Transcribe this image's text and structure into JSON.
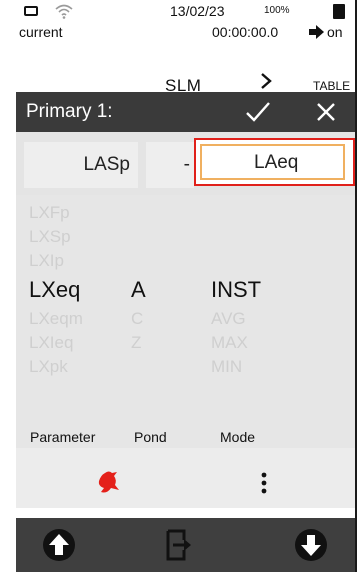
{
  "status_bar": {
    "date": "13/02/23",
    "battery_percent": "100%",
    "mode": "current",
    "timer": "00:00:00.0",
    "rec_state": "on"
  },
  "nav": {
    "title": "SLM",
    "next_label": "TABLE"
  },
  "header": {
    "title": "Primary 1:",
    "icons": [
      "check-icon",
      "close-icon"
    ]
  },
  "selection": {
    "field_a": "LASp",
    "field_b": "-",
    "field_c": "LAeq"
  },
  "picker": {
    "parameter": {
      "options": [
        "LXFp",
        "LXSp",
        "LXIp",
        "LXeq",
        "LXeqm",
        "LXIeq",
        "LXpk"
      ],
      "selected": "LXeq",
      "label": "Parameter"
    },
    "pond": {
      "options": [
        "A",
        "C",
        "Z"
      ],
      "selected": "A",
      "label": "Pond"
    },
    "mode": {
      "options": [
        "INST",
        "AVG",
        "MAX",
        "MIN"
      ],
      "selected": "INST",
      "label": "Mode"
    }
  },
  "tools": {
    "left_icon": "bird-icon",
    "right_icon": "kebab-menu-icon",
    "accent": "#e4201a"
  },
  "bottom_bar": {
    "icons": [
      "arrow-up-circle-icon",
      "exit-icon",
      "arrow-down-circle-icon"
    ]
  }
}
